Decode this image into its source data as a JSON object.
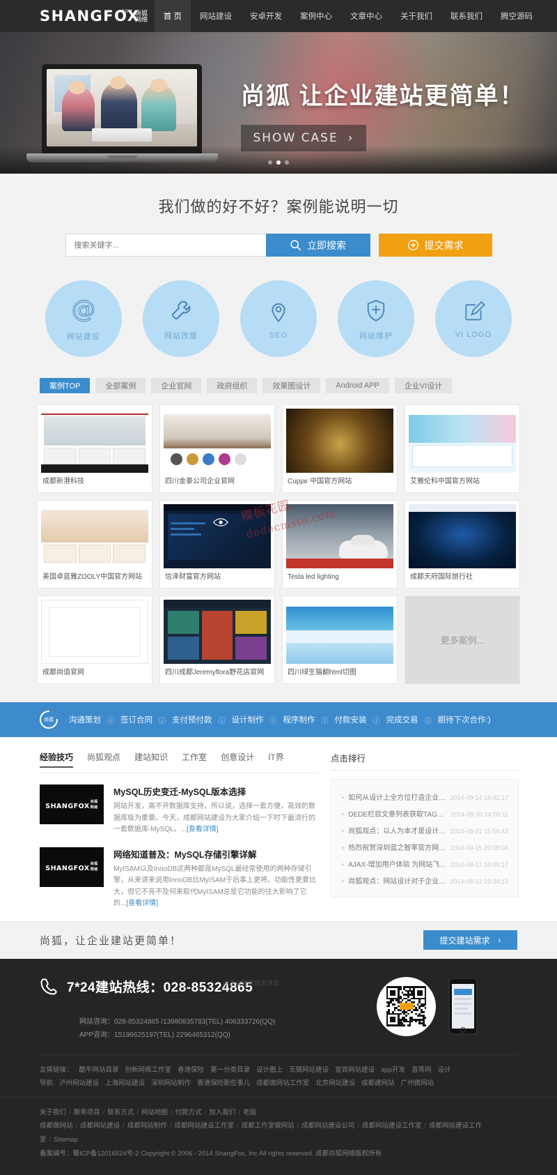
{
  "header": {
    "logo": {
      "main": "SHANGFOX",
      "com": ".COM",
      "cn_top": "尚狐",
      "cn_bottom": "网络"
    },
    "nav": [
      {
        "label": "首 页",
        "active": true
      },
      {
        "label": "网站建设",
        "active": false
      },
      {
        "label": "安卓开发",
        "active": false
      },
      {
        "label": "案例中心",
        "active": false
      },
      {
        "label": "文章中心",
        "active": false
      },
      {
        "label": "关于我们",
        "active": false
      },
      {
        "label": "联系我们",
        "active": false
      },
      {
        "label": "腾空源码",
        "active": false
      }
    ]
  },
  "hero": {
    "title": "尚狐  让企业建站更简单！",
    "button": "SHOW CASE",
    "button_arrow": "›",
    "dots": 3,
    "active_dot": 2
  },
  "search": {
    "title": "我们做的好不好？案例能说明一切",
    "placeholder": "搜索关键字...",
    "value": "",
    "search_button": "立即搜索",
    "submit_button": "提交需求"
  },
  "services": [
    {
      "label": "网站建设",
      "icon": "at-icon"
    },
    {
      "label": "网站改版",
      "icon": "wrench-icon"
    },
    {
      "label": "SEO",
      "icon": "location-pin-icon"
    },
    {
      "label": "网站维护",
      "icon": "shield-plus-icon"
    },
    {
      "label": "VI LOGO",
      "icon": "edit-square-icon"
    }
  ],
  "case_tabs": [
    {
      "label": "案例TOP",
      "active": true
    },
    {
      "label": "全部案例",
      "active": false
    },
    {
      "label": "企业官网",
      "active": false
    },
    {
      "label": "政府组织",
      "active": false
    },
    {
      "label": "效果图设计",
      "active": false
    },
    {
      "label": "Android APP",
      "active": false
    },
    {
      "label": "企业VI设计",
      "active": false
    }
  ],
  "cases": [
    {
      "caption": "成都新港科技",
      "mock": "a"
    },
    {
      "caption": "四川金豪公司企业官网",
      "mock": "b"
    },
    {
      "caption": "Cupjar 中国官方网站",
      "mock": "c"
    },
    {
      "caption": "艾雅伦科中国官方网站",
      "mock": "d"
    },
    {
      "caption": "美国卓蓝雅ZOOLY中国官方网站",
      "mock": "e"
    },
    {
      "caption": "信泽财富官方网站",
      "mock": "f"
    },
    {
      "caption": "Tesla led lighting",
      "mock": "g"
    },
    {
      "caption": "成都天府国际旅行社",
      "mock": "h"
    },
    {
      "caption": "成都尚值官网",
      "mock": "i"
    },
    {
      "caption": "四川成都Jeremyflora野花店官网",
      "mock": "j"
    },
    {
      "caption": "四川绿生猫翻html切图",
      "mock": "k"
    }
  ],
  "more_case": "更多案例...",
  "watermark": {
    "line1": "模板花园",
    "line2": "dedecmsto.com"
  },
  "process": {
    "logo_text": "尚狐",
    "steps": [
      "沟通策划",
      "签订合同",
      "支付预付款",
      "设计制作",
      "程序制作",
      "付款安装",
      "完成交易",
      "期待下次合作:)"
    ],
    "separator": "ⓘ"
  },
  "news": {
    "tabs": [
      {
        "label": "经验技巧",
        "active": true
      },
      {
        "label": "尚狐观点",
        "active": false
      },
      {
        "label": "建站知识",
        "active": false
      },
      {
        "label": "工作室",
        "active": false
      },
      {
        "label": "创意设计",
        "active": false
      },
      {
        "label": "IT界",
        "active": false
      }
    ],
    "items": [
      {
        "title": "MySQL历史变迁-MySQL版本选择",
        "desc": "网站开发，离不开数据库支持，所以说，选择一套方便，高效的数据库极为重要。今天，成都网站建设为大家介绍一下时下最流行的一套数据库-MySQL。...",
        "more": "[查看详情]",
        "thumb_logo": "SHANGFOX 尚狐网络"
      },
      {
        "title": "网络知道普及：MySQL存储引擎详解",
        "desc": "MyISAM以及InnoDB这两种都是MySQL最经常使用的两种存储引擎，从来讲来说用InnoDB比MyISAM于后事上更将。功能性更要比大，但它不亮不及何来取代MyISAM总是它功能的往大影响了它的...",
        "more": "[查看详情]",
        "thumb_logo": "SHANGFOX 尚狐网络"
      }
    ],
    "rank_title": "点击排行",
    "rank": [
      {
        "title": "如何从设计上全方位打造企业官网",
        "date": "2014-09-14 16:42:17"
      },
      {
        "title": "DEDE栏目文章列表获取TAGS解决方法",
        "date": "2014-09-30 14:09:11"
      },
      {
        "title": "尚狐观点：以人为本才是设计王道",
        "date": "2014-08-21 15:56:42"
      },
      {
        "title": "热烈祝贺深圳蓝之智率官方网站交付上线",
        "date": "2014-09-15 20:08:04"
      },
      {
        "title": "AJAX-增加用户体验 为网站飞一会儿",
        "date": "2014-08-17 16:09:17"
      },
      {
        "title": "尚狐观点：网站设计对于企业的重要性",
        "date": "2014-08-12 19:34:13"
      }
    ]
  },
  "cta": {
    "text": "尚狐，让企业建站更简单！",
    "button": "提交建站需求",
    "arrow": "›"
  },
  "footer": {
    "phone_label": "7*24建站热线：",
    "phone_number": "028-85324865",
    "note": "点击以警位我发消息",
    "contact_lines": [
      "网站咨询：028-85324865 /13980835783(TEL) 406333726(QQ)",
      "APP咨询：15196625197(TEL) 2296465312(QQ)"
    ],
    "friend_label": "友情链接：",
    "friend_links_row1": [
      "酷牛网站目录",
      "创新网络工作室",
      "香港保险",
      "第一分类目录",
      "设计圈上",
      "无锡网站建设",
      "宜宾网站建设",
      "app开发",
      "直等网",
      "设计"
    ],
    "friend_links_row2": [
      "导航",
      "泸州网站建设",
      "上海网站建设",
      "深圳网站制作",
      "香港保险那些事儿",
      "成都做网站工作室",
      "北京网站建设",
      "成都建网站",
      "广州做网站"
    ],
    "bottom_row1": [
      "关于我们",
      "服务项目",
      "联系方式",
      "网站地图",
      "付款方式",
      "加入我们",
      "老版"
    ],
    "bottom_row2": [
      "成都做网站",
      "成都网站建设",
      "成都网站制作",
      "成都网站建设工作室",
      "成都工作室做网站",
      "成都网站建设公司",
      "成都网站建设工作室",
      "成都网站建设工作室",
      "Sitemap"
    ],
    "copyright": "备案编号：蜀ICP备12016524号-2 Copyright © 2006 - 2014 ShangFox, Inc All rights reserved.  成都尚狐网络版权所有"
  },
  "colors": {
    "accent_blue": "#3a8ccc",
    "accent_orange": "#f0a011",
    "circle_blue": "#b7dcf5",
    "header_dark": "#2b2b2b",
    "footer_dark": "#252525"
  }
}
